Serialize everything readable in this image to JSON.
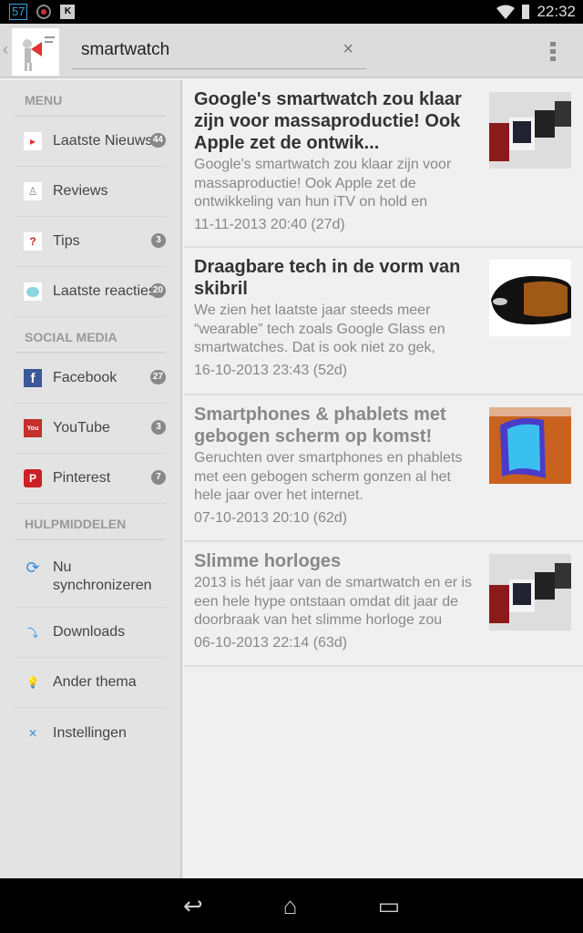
{
  "status": {
    "notif_badge": "57",
    "time": "22:32"
  },
  "action_bar": {
    "search_value": "smartwatch",
    "clear": "×"
  },
  "sidebar": {
    "sections": [
      {
        "title": "MENU",
        "items": [
          {
            "label": "Laatste Nieuws",
            "badge": "44",
            "icon": "megaphone-icon"
          },
          {
            "label": "Reviews",
            "badge": null,
            "icon": "reviews-icon"
          },
          {
            "label": "Tips",
            "badge": "3",
            "icon": "question-icon"
          },
          {
            "label": "Laatste reacties",
            "badge": "20",
            "icon": "comment-icon"
          }
        ]
      },
      {
        "title": "SOCIAL MEDIA",
        "items": [
          {
            "label": "Facebook",
            "badge": "27",
            "icon": "facebook-icon"
          },
          {
            "label": "YouTube",
            "badge": "3",
            "icon": "youtube-icon"
          },
          {
            "label": "Pinterest",
            "badge": "7",
            "icon": "pinterest-icon"
          }
        ]
      },
      {
        "title": "HULPMIDDELEN",
        "items": [
          {
            "label": "Nu synchronizeren",
            "icon": "sync-icon"
          },
          {
            "label": "Downloads",
            "icon": "download-icon"
          },
          {
            "label": "Ander thema",
            "icon": "lightbulb-icon"
          },
          {
            "label": "Instellingen",
            "icon": "tools-icon"
          }
        ]
      }
    ]
  },
  "articles": [
    {
      "title": "Google's smartwatch zou klaar zijn voor massaproductie! Ook Apple zet de ontwik...",
      "excerpt": "Google's smartwatch zou klaar zijn voor massaproductie! Ook Apple zet de ontwikkeling van hun iTV on hold en",
      "date": "11-11-2013 20:40 (27d)",
      "read": false
    },
    {
      "title": "Draagbare tech in de vorm van skibril",
      "excerpt": "We zien het laatste jaar steeds meer “wearable” tech zoals Google Glass en smartwatches. Dat is ook niet zo gek,",
      "date": "16-10-2013 23:43 (52d)",
      "read": false
    },
    {
      "title": "Smartphones & phablets met gebogen scherm op komst!",
      "excerpt": "Geruchten over smartphones en phablets met een gebogen scherm gonzen al het hele jaar over het internet.",
      "date": "07-10-2013 20:10 (62d)",
      "read": true
    },
    {
      "title": "Slimme horloges",
      "excerpt": "2013 is hét jaar van de smartwatch en er is een hele hype ontstaan omdat dit jaar de doorbraak van het slimme horloge zou",
      "date": "06-10-2013 22:14 (63d)",
      "read": true
    }
  ]
}
